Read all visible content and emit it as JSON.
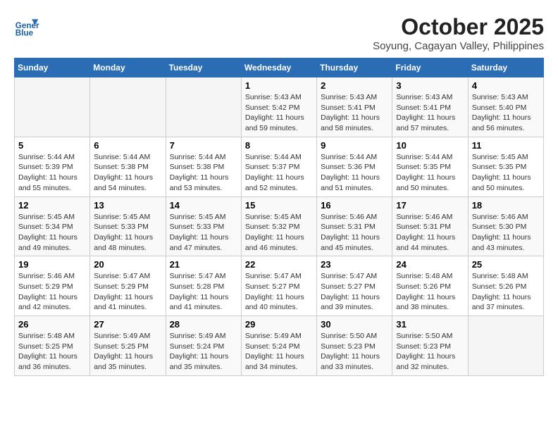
{
  "header": {
    "logo_text_general": "General",
    "logo_text_blue": "Blue",
    "month_title": "October 2025",
    "location": "Soyung, Cagayan Valley, Philippines"
  },
  "weekdays": [
    "Sunday",
    "Monday",
    "Tuesday",
    "Wednesday",
    "Thursday",
    "Friday",
    "Saturday"
  ],
  "weeks": [
    [
      {
        "day": "",
        "sunrise": "",
        "sunset": "",
        "daylight": ""
      },
      {
        "day": "",
        "sunrise": "",
        "sunset": "",
        "daylight": ""
      },
      {
        "day": "",
        "sunrise": "",
        "sunset": "",
        "daylight": ""
      },
      {
        "day": "1",
        "sunrise": "Sunrise: 5:43 AM",
        "sunset": "Sunset: 5:42 PM",
        "daylight": "Daylight: 11 hours and 59 minutes."
      },
      {
        "day": "2",
        "sunrise": "Sunrise: 5:43 AM",
        "sunset": "Sunset: 5:41 PM",
        "daylight": "Daylight: 11 hours and 58 minutes."
      },
      {
        "day": "3",
        "sunrise": "Sunrise: 5:43 AM",
        "sunset": "Sunset: 5:41 PM",
        "daylight": "Daylight: 11 hours and 57 minutes."
      },
      {
        "day": "4",
        "sunrise": "Sunrise: 5:43 AM",
        "sunset": "Sunset: 5:40 PM",
        "daylight": "Daylight: 11 hours and 56 minutes."
      }
    ],
    [
      {
        "day": "5",
        "sunrise": "Sunrise: 5:44 AM",
        "sunset": "Sunset: 5:39 PM",
        "daylight": "Daylight: 11 hours and 55 minutes."
      },
      {
        "day": "6",
        "sunrise": "Sunrise: 5:44 AM",
        "sunset": "Sunset: 5:38 PM",
        "daylight": "Daylight: 11 hours and 54 minutes."
      },
      {
        "day": "7",
        "sunrise": "Sunrise: 5:44 AM",
        "sunset": "Sunset: 5:38 PM",
        "daylight": "Daylight: 11 hours and 53 minutes."
      },
      {
        "day": "8",
        "sunrise": "Sunrise: 5:44 AM",
        "sunset": "Sunset: 5:37 PM",
        "daylight": "Daylight: 11 hours and 52 minutes."
      },
      {
        "day": "9",
        "sunrise": "Sunrise: 5:44 AM",
        "sunset": "Sunset: 5:36 PM",
        "daylight": "Daylight: 11 hours and 51 minutes."
      },
      {
        "day": "10",
        "sunrise": "Sunrise: 5:44 AM",
        "sunset": "Sunset: 5:35 PM",
        "daylight": "Daylight: 11 hours and 50 minutes."
      },
      {
        "day": "11",
        "sunrise": "Sunrise: 5:45 AM",
        "sunset": "Sunset: 5:35 PM",
        "daylight": "Daylight: 11 hours and 50 minutes."
      }
    ],
    [
      {
        "day": "12",
        "sunrise": "Sunrise: 5:45 AM",
        "sunset": "Sunset: 5:34 PM",
        "daylight": "Daylight: 11 hours and 49 minutes."
      },
      {
        "day": "13",
        "sunrise": "Sunrise: 5:45 AM",
        "sunset": "Sunset: 5:33 PM",
        "daylight": "Daylight: 11 hours and 48 minutes."
      },
      {
        "day": "14",
        "sunrise": "Sunrise: 5:45 AM",
        "sunset": "Sunset: 5:33 PM",
        "daylight": "Daylight: 11 hours and 47 minutes."
      },
      {
        "day": "15",
        "sunrise": "Sunrise: 5:45 AM",
        "sunset": "Sunset: 5:32 PM",
        "daylight": "Daylight: 11 hours and 46 minutes."
      },
      {
        "day": "16",
        "sunrise": "Sunrise: 5:46 AM",
        "sunset": "Sunset: 5:31 PM",
        "daylight": "Daylight: 11 hours and 45 minutes."
      },
      {
        "day": "17",
        "sunrise": "Sunrise: 5:46 AM",
        "sunset": "Sunset: 5:31 PM",
        "daylight": "Daylight: 11 hours and 44 minutes."
      },
      {
        "day": "18",
        "sunrise": "Sunrise: 5:46 AM",
        "sunset": "Sunset: 5:30 PM",
        "daylight": "Daylight: 11 hours and 43 minutes."
      }
    ],
    [
      {
        "day": "19",
        "sunrise": "Sunrise: 5:46 AM",
        "sunset": "Sunset: 5:29 PM",
        "daylight": "Daylight: 11 hours and 42 minutes."
      },
      {
        "day": "20",
        "sunrise": "Sunrise: 5:47 AM",
        "sunset": "Sunset: 5:29 PM",
        "daylight": "Daylight: 11 hours and 41 minutes."
      },
      {
        "day": "21",
        "sunrise": "Sunrise: 5:47 AM",
        "sunset": "Sunset: 5:28 PM",
        "daylight": "Daylight: 11 hours and 41 minutes."
      },
      {
        "day": "22",
        "sunrise": "Sunrise: 5:47 AM",
        "sunset": "Sunset: 5:27 PM",
        "daylight": "Daylight: 11 hours and 40 minutes."
      },
      {
        "day": "23",
        "sunrise": "Sunrise: 5:47 AM",
        "sunset": "Sunset: 5:27 PM",
        "daylight": "Daylight: 11 hours and 39 minutes."
      },
      {
        "day": "24",
        "sunrise": "Sunrise: 5:48 AM",
        "sunset": "Sunset: 5:26 PM",
        "daylight": "Daylight: 11 hours and 38 minutes."
      },
      {
        "day": "25",
        "sunrise": "Sunrise: 5:48 AM",
        "sunset": "Sunset: 5:26 PM",
        "daylight": "Daylight: 11 hours and 37 minutes."
      }
    ],
    [
      {
        "day": "26",
        "sunrise": "Sunrise: 5:48 AM",
        "sunset": "Sunset: 5:25 PM",
        "daylight": "Daylight: 11 hours and 36 minutes."
      },
      {
        "day": "27",
        "sunrise": "Sunrise: 5:49 AM",
        "sunset": "Sunset: 5:25 PM",
        "daylight": "Daylight: 11 hours and 35 minutes."
      },
      {
        "day": "28",
        "sunrise": "Sunrise: 5:49 AM",
        "sunset": "Sunset: 5:24 PM",
        "daylight": "Daylight: 11 hours and 35 minutes."
      },
      {
        "day": "29",
        "sunrise": "Sunrise: 5:49 AM",
        "sunset": "Sunset: 5:24 PM",
        "daylight": "Daylight: 11 hours and 34 minutes."
      },
      {
        "day": "30",
        "sunrise": "Sunrise: 5:50 AM",
        "sunset": "Sunset: 5:23 PM",
        "daylight": "Daylight: 11 hours and 33 minutes."
      },
      {
        "day": "31",
        "sunrise": "Sunrise: 5:50 AM",
        "sunset": "Sunset: 5:23 PM",
        "daylight": "Daylight: 11 hours and 32 minutes."
      },
      {
        "day": "",
        "sunrise": "",
        "sunset": "",
        "daylight": ""
      }
    ]
  ]
}
